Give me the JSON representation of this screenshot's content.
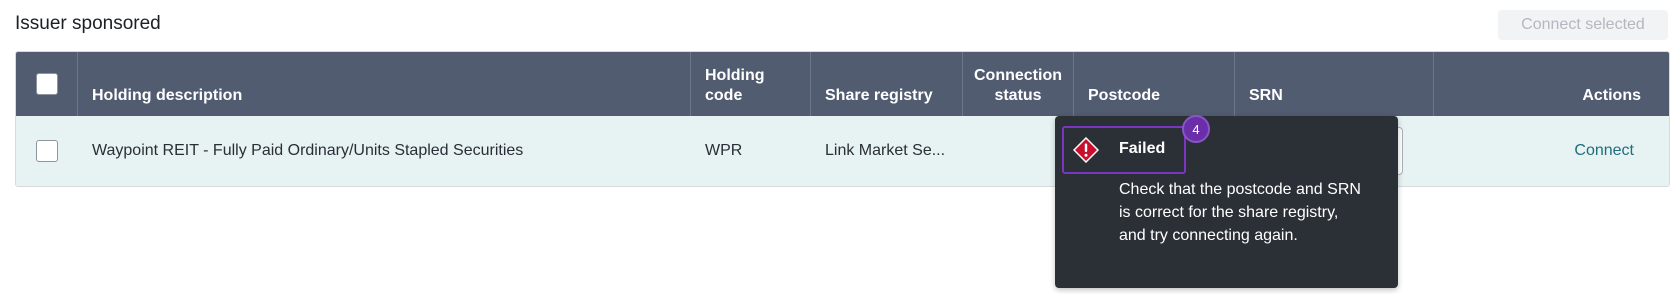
{
  "section": {
    "title": "Issuer sponsored",
    "connect_selected_label": "Connect selected"
  },
  "table": {
    "headers": {
      "holding_description": "Holding description",
      "holding_code_line1": "Holding",
      "holding_code_line2": "code",
      "share_registry": "Share registry",
      "connection_status_line1": "Connection",
      "connection_status_line2": "status",
      "postcode": "Postcode",
      "srn": "SRN",
      "actions": "Actions"
    },
    "rows": [
      {
        "holding_description": "Waypoint REIT - Fully Paid Ordinary/Units Stapled Securities",
        "holding_code": "WPR",
        "share_registry": "Link Market Se...",
        "srn_value": "••••••",
        "action_label": "Connect"
      }
    ]
  },
  "tooltip": {
    "status": "Failed",
    "badge": "4",
    "message": "Check that the postcode and SRN is correct for the share registry, and try connecting again.",
    "icon": "error-diamond-icon",
    "icon_color": "#c8102e"
  },
  "colors": {
    "header_bg": "#525c70",
    "row_bg": "#e7f2f3",
    "link": "#1f6e7b",
    "tooltip_bg": "#2b2f36",
    "highlight": "#7a35c2"
  }
}
